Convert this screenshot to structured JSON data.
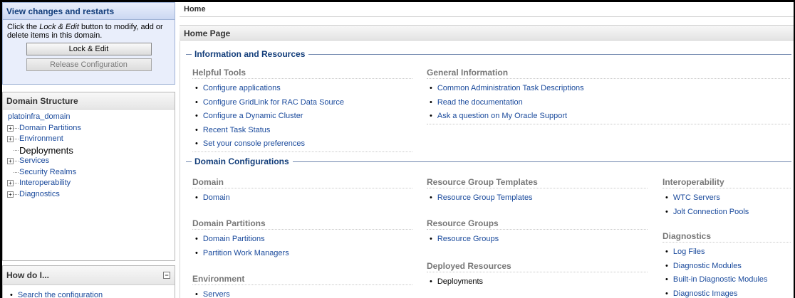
{
  "changes": {
    "title": "View changes and restarts",
    "text_before": "Click the ",
    "text_em": "Lock & Edit",
    "text_after": " button to modify, add or delete items in this domain.",
    "lock_edit_label": "Lock & Edit",
    "release_label": "Release Configuration"
  },
  "structure": {
    "title": "Domain Structure",
    "root": "platoinfra_domain",
    "items": [
      {
        "label": "Domain Partitions",
        "expandable": true
      },
      {
        "label": "Environment",
        "expandable": true
      },
      {
        "label": "Deployments",
        "expandable": false
      },
      {
        "label": "Services",
        "expandable": true
      },
      {
        "label": "Security Realms",
        "expandable": false
      },
      {
        "label": "Interoperability",
        "expandable": true
      },
      {
        "label": "Diagnostics",
        "expandable": true
      }
    ]
  },
  "howdo": {
    "title": "How do I...",
    "items": [
      "Search the configuration"
    ]
  },
  "breadcrumb": "Home",
  "page_title": "Home Page",
  "info_section": {
    "title": "Information and Resources",
    "helpful_tools": {
      "title": "Helpful Tools",
      "items": [
        "Configure applications",
        "Configure GridLink for RAC Data Source",
        "Configure a Dynamic Cluster",
        "Recent Task Status",
        "Set your console preferences"
      ]
    },
    "general_info": {
      "title": "General Information",
      "items": [
        "Common Administration Task Descriptions",
        "Read the documentation",
        "Ask a question on My Oracle Support"
      ]
    }
  },
  "domain_section": {
    "title": "Domain Configurations",
    "domain": {
      "title": "Domain",
      "items": [
        "Domain"
      ]
    },
    "domain_partitions": {
      "title": "Domain Partitions",
      "items": [
        "Domain Partitions",
        "Partition Work Managers"
      ]
    },
    "environment": {
      "title": "Environment",
      "items": [
        "Servers"
      ]
    },
    "rg_templates": {
      "title": "Resource Group Templates",
      "items": [
        "Resource Group Templates"
      ]
    },
    "resource_groups": {
      "title": "Resource Groups",
      "items": [
        "Resource Groups"
      ]
    },
    "deployed_resources": {
      "title": "Deployed Resources",
      "items": [
        "Deployments"
      ]
    },
    "interoperability": {
      "title": "Interoperability",
      "items": [
        "WTC Servers",
        "Jolt Connection Pools"
      ]
    },
    "diagnostics": {
      "title": "Diagnostics",
      "items": [
        "Log Files",
        "Diagnostic Modules",
        "Built-in Diagnostic Modules",
        "Diagnostic Images"
      ]
    }
  },
  "colors": {
    "link": "#1a4a9c",
    "section_title": "#123d7a",
    "group_title": "#777777"
  }
}
